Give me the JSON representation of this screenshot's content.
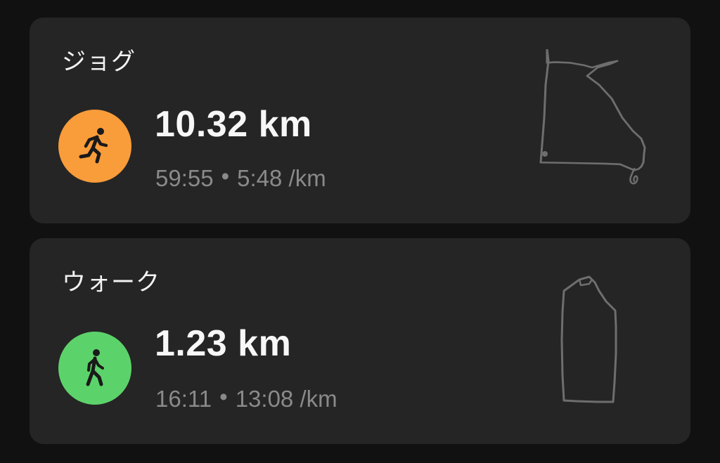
{
  "workouts": [
    {
      "title": "ジョグ",
      "icon": "running-figure-icon",
      "icon_color": "#f99c3a",
      "distance": "10.32 km",
      "duration": "59:55",
      "separator": "•",
      "pace": "5:48 /km"
    },
    {
      "title": "ウォーク",
      "icon": "walking-figure-icon",
      "icon_color": "#5cd36a",
      "distance": "1.23 km",
      "duration": "16:11",
      "separator": "•",
      "pace": "13:08 /km"
    }
  ],
  "colors": {
    "background": "#111111",
    "card": "#252525",
    "route_line": "#6e6e6e"
  }
}
